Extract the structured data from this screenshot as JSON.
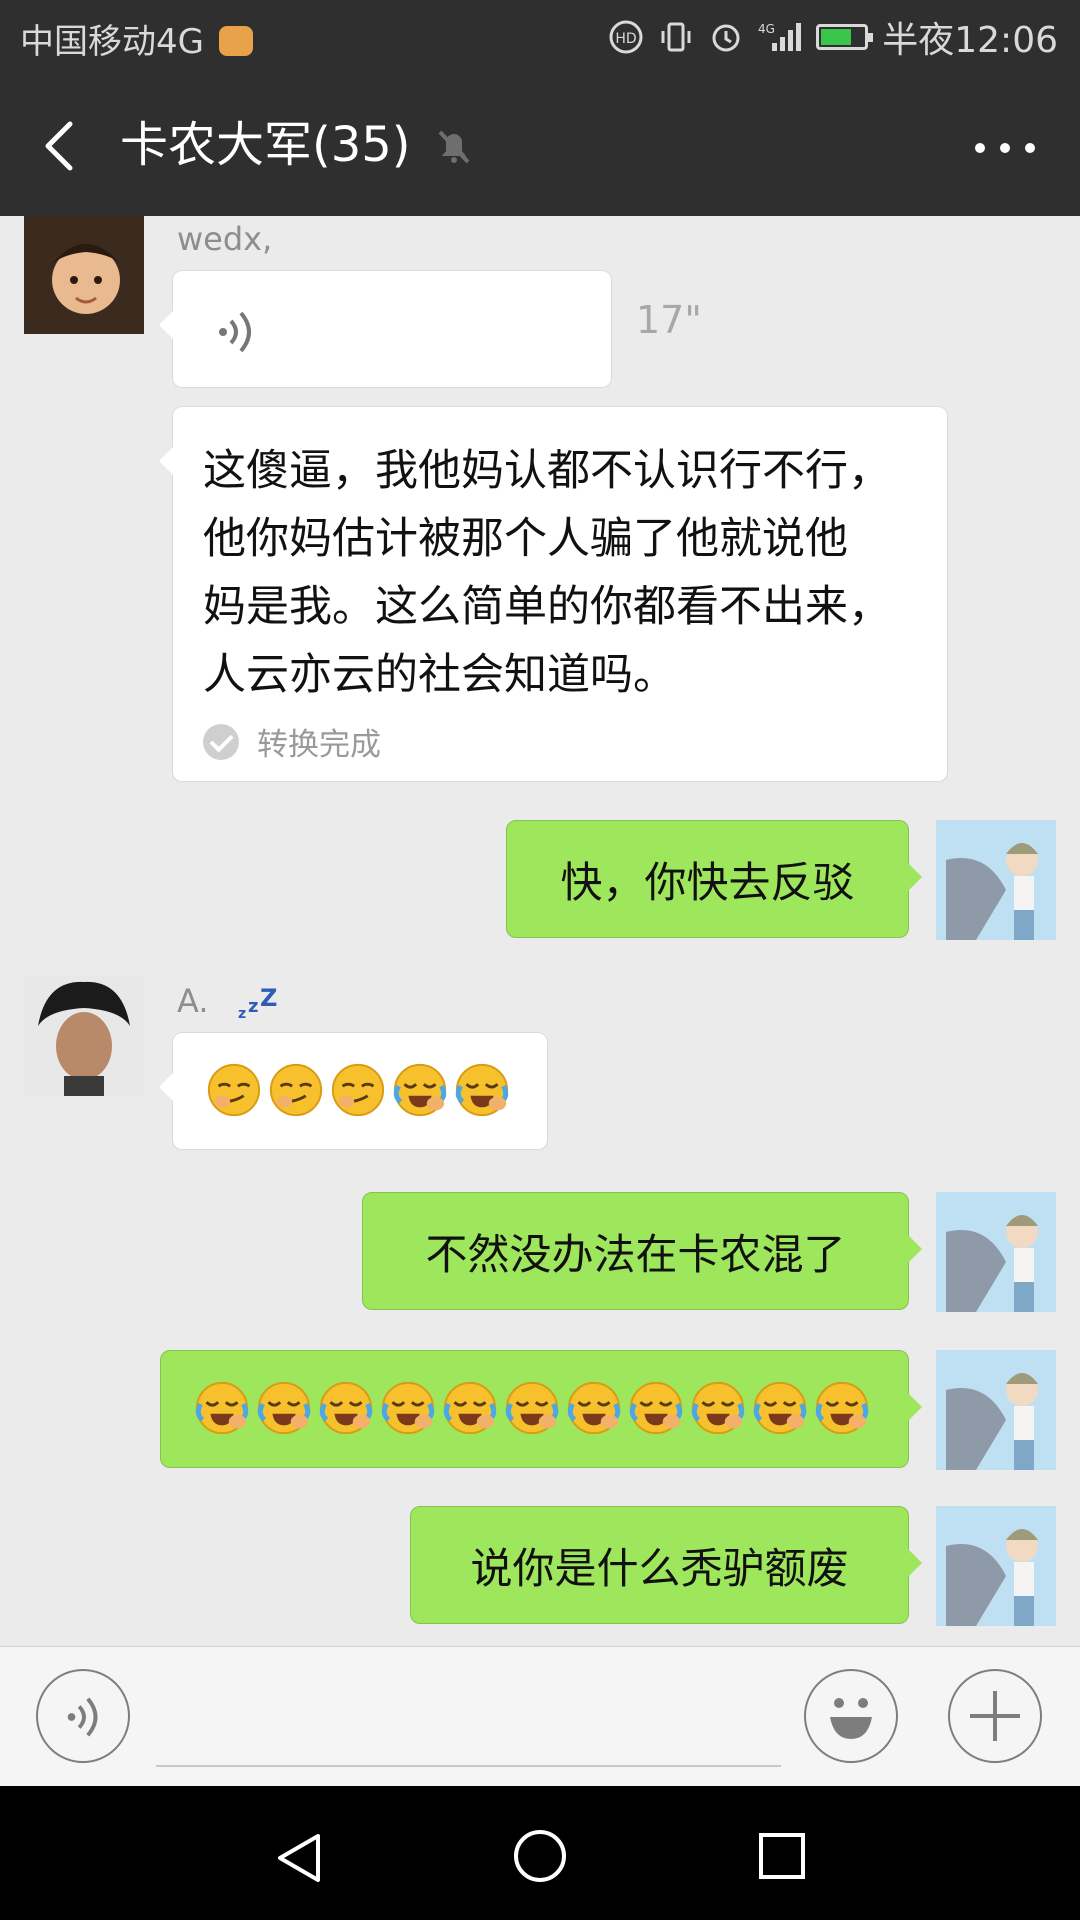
{
  "status_bar": {
    "carrier": "中国移动4G",
    "time": "半夜12:06",
    "icons": [
      "hd-call-icon",
      "vibrate-icon",
      "alarm-icon",
      "signal-4g-icon",
      "battery-charging-icon"
    ]
  },
  "header": {
    "title": "卡农大军(35)",
    "back_icon": "back-chevron-icon",
    "mute_icon": "muted-bell-icon",
    "more_icon": "more-dots-icon"
  },
  "messages": [
    {
      "side": "left",
      "sender": "wedx,",
      "type": "voice",
      "duration": "17\""
    },
    {
      "side": "left",
      "type": "transcript",
      "lines": [
        "这傻逼，我他妈认都不认识行不行，",
        "他你妈估计被那个人骗了他就说他",
        "妈是我。这么简单的你都看不出来，",
        "人云亦云的社会知道吗。"
      ],
      "status": "转换完成"
    },
    {
      "side": "right",
      "type": "text",
      "text": "快，你快去反驳"
    },
    {
      "side": "left",
      "sender": "A.",
      "type": "emoji",
      "emojis": [
        "smirk-emoji",
        "smirk-emoji",
        "smirk-emoji",
        "crying-laughing-emoji",
        "crying-laughing-emoji"
      ]
    },
    {
      "side": "right",
      "type": "text",
      "text": "不然没办法在卡农混了"
    },
    {
      "side": "right",
      "type": "emoji",
      "count": 11,
      "emoji": "crying-laughing-emoji"
    },
    {
      "side": "right",
      "type": "text",
      "text": "说你是什么秃驴额废"
    }
  ],
  "input_bar": {
    "voice_button": "voice-mode-icon",
    "emoji_button": "emoji-face-icon",
    "plus_button": "plus-icon"
  },
  "nav_bar": {
    "buttons": [
      "back-triangle-icon",
      "home-circle-icon",
      "recents-square-icon"
    ]
  }
}
